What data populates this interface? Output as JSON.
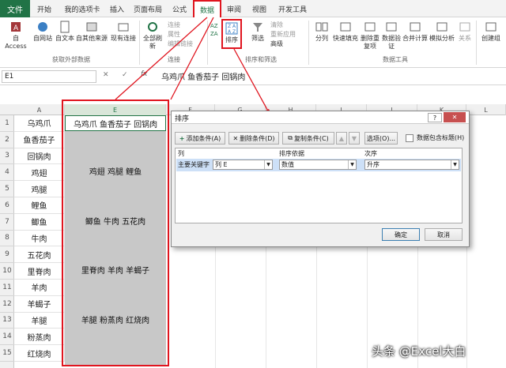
{
  "tabs": [
    "文件",
    "开始",
    "我的选项卡",
    "插入",
    "页面布局",
    "公式",
    "数据",
    "审阅",
    "视图",
    "开发工具"
  ],
  "ribbon": {
    "ext_buttons": [
      "自 Access",
      "自网站",
      "自文本",
      "自其他来源",
      "现有连接"
    ],
    "ext_group": "获取外部数据",
    "refresh_label": "全部刷新",
    "conn_items": [
      "连接",
      "属性",
      "编辑链接"
    ],
    "conn_group": "连接",
    "sort_label": "排序",
    "filter_label": "筛选",
    "filter_items": [
      "清除",
      "重新应用",
      "高级"
    ],
    "sort_group": "排序和筛选",
    "tool_buttons": [
      "分列",
      "快速填充",
      "删除重复项",
      "数据验证",
      "合并计算",
      "模拟分析",
      "关系"
    ],
    "tool_group": "数据工具",
    "outline_label": "创建组"
  },
  "formula": {
    "name_box": "E1",
    "fx": "fx",
    "content": "乌鸡爪  鱼香茄子  回锅肉"
  },
  "columns": {
    "A": "A",
    "E": "E",
    "F": "F",
    "G": "G",
    "H": "H",
    "I": "I",
    "J": "J",
    "K": "K",
    "L": "L"
  },
  "rows": [
    "1",
    "2",
    "3",
    "4",
    "5",
    "6",
    "7",
    "8",
    "9",
    "10",
    "11",
    "12",
    "13",
    "14",
    "15"
  ],
  "col_a": [
    "乌鸡爪",
    "鱼香茄子",
    "回锅肉",
    "鸡翅",
    "鸡腿",
    "鲤鱼",
    "鲫鱼",
    "牛肉",
    "五花肉",
    "里脊肉",
    "羊肉",
    "羊蝎子",
    "羊腿",
    "粉蒸肉",
    "红烧肉"
  ],
  "col_e": {
    "e1": "乌鸡爪  鱼香茄子  回锅肉",
    "g1": "鸡翅  鸡腿  鲤鱼",
    "g2": "鲫鱼  牛肉  五花肉",
    "g3": "里脊肉  羊肉  羊蝎子",
    "g4": "羊腿  粉蒸肉  红烧肉"
  },
  "dialog": {
    "title": "排序",
    "help": "?",
    "close": "✕",
    "add": "添加条件(A)",
    "delete": "删除条件(D)",
    "copy": "复制条件(C)",
    "options": "选项(O)...",
    "header_check": "数据包含标题(H)",
    "col_header": "列",
    "basis_header": "排序依据",
    "order_header": "次序",
    "key_label": "主要关键字",
    "key_value": "列 E",
    "basis_value": "数值",
    "order_value": "升序",
    "ok": "确定",
    "cancel": "取消"
  },
  "watermark": "头条 @Excel大白",
  "colors": {
    "excel_green": "#217346",
    "highlight_red": "#e0151f"
  }
}
